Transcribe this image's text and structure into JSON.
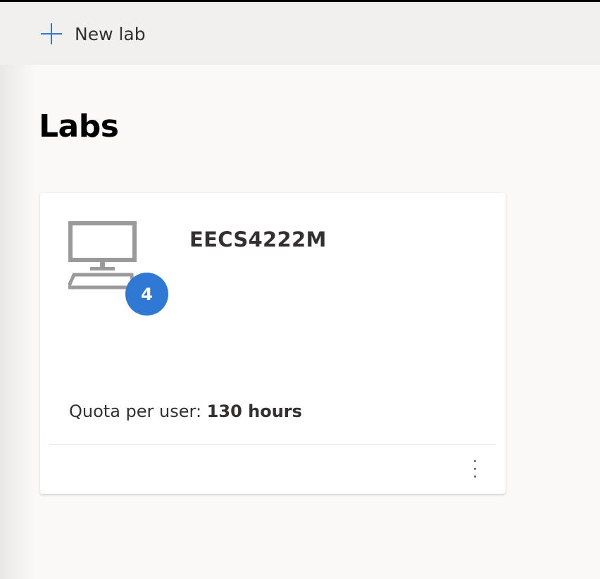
{
  "toolbar": {
    "new_lab_label": "New lab"
  },
  "page": {
    "title": "Labs"
  },
  "labs": [
    {
      "name": "EECS4222M",
      "vm_count": "4",
      "quota_label": "Quota per user: ",
      "quota_value": "130 hours"
    }
  ],
  "icons": {
    "new_lab": "plus-icon",
    "vm": "monitor-icon",
    "more": "more-vertical-icon"
  },
  "colors": {
    "accent": "#2f78d4",
    "toolbar_bg": "#f1f0ef",
    "page_bg": "#faf9f8",
    "icon_gray": "#9a9a9a"
  }
}
